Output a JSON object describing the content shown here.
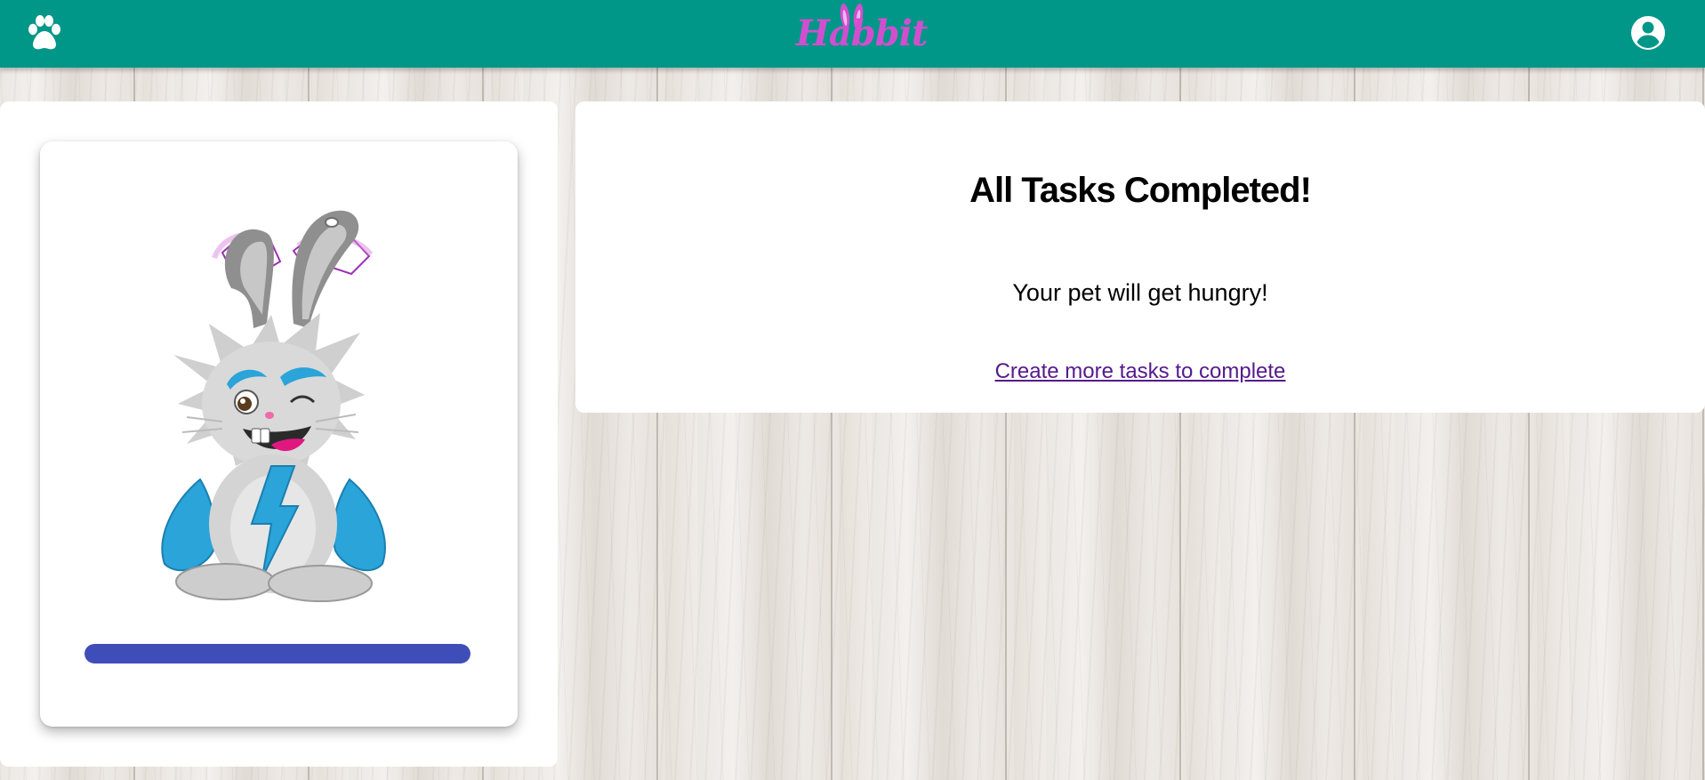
{
  "app": {
    "logo_text": "Habbit",
    "brand_color": "#009688",
    "logo_color": "#d14fcf"
  },
  "header": {
    "left_icon": "paw-icon",
    "right_icon": "account-circle-icon"
  },
  "pet": {
    "image_description": "bunny-pet-icon",
    "health_level": 1.0,
    "health_bar_color": "#3f4db8"
  },
  "tasks": {
    "title": "All Tasks Completed!",
    "message": "Your pet will get hungry!",
    "link_text": "Create more tasks to complete",
    "link_color": "#551a8b"
  }
}
